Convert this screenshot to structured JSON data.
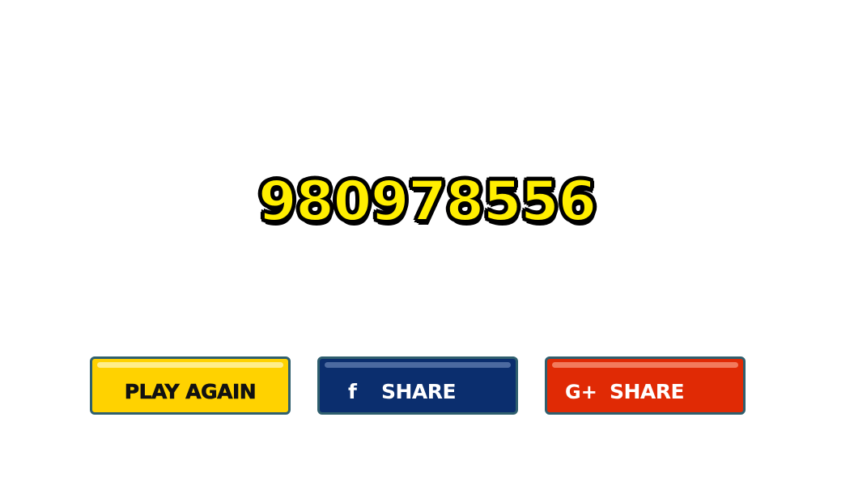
{
  "score": {
    "value": "980978556",
    "color": "#ffee00"
  },
  "buttons": {
    "play_again": {
      "label": "PLAY AGAIN",
      "color": "#ffd200"
    },
    "facebook_share": {
      "icon_glyph": "f",
      "icon": "facebook-icon",
      "label": "SHARE",
      "color": "#0b2e6e"
    },
    "google_plus_share": {
      "icon_glyph": "G+",
      "icon": "google-plus-icon",
      "label": "SHARE",
      "color": "#e02a05"
    }
  }
}
